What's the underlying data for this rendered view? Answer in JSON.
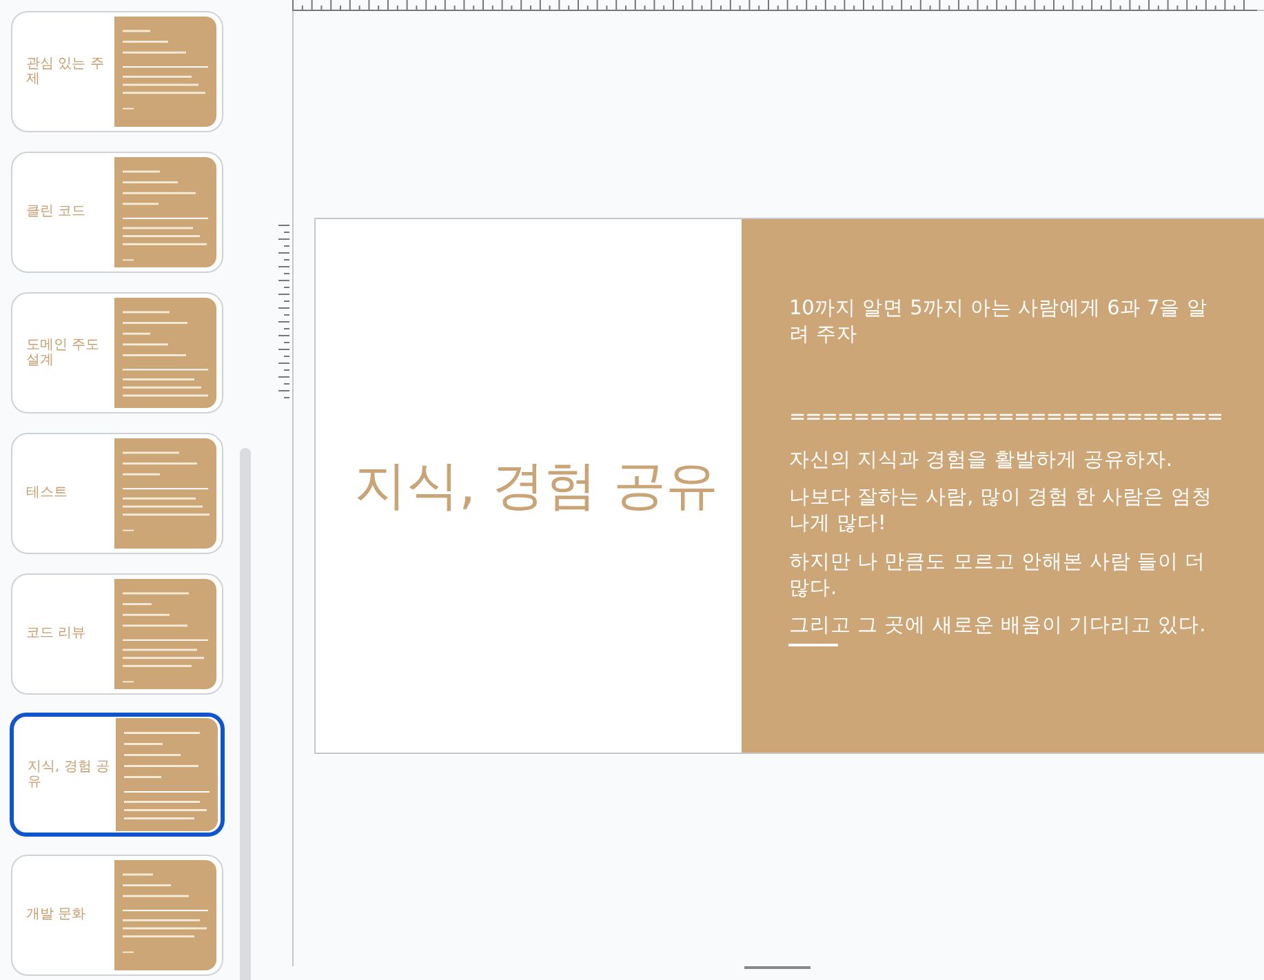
{
  "slides": [
    {
      "title": "관심 있는 주제",
      "selected": false
    },
    {
      "title": "클린 코드",
      "selected": false
    },
    {
      "title": "도메인 주도 설계",
      "selected": false
    },
    {
      "title": "테스트",
      "selected": false
    },
    {
      "title": "코드 리뷰",
      "selected": false
    },
    {
      "title": "지식, 경험 공유",
      "selected": true
    },
    {
      "title": "개발 문화",
      "selected": false
    }
  ],
  "current_slide": {
    "title": "지식, 경험 공유",
    "lead": "10까지 알면 5까지 아는 사람에게 6과 7을 알려 주자",
    "separator": "===========================",
    "paragraphs": [
      "자신의 지식과 경험을 활발하게 공유하자.",
      "나보다 잘하는 사람, 많이 경험 한 사람은 엄청나게 많다!",
      "하지만 나 만큼도 모르고 안해본 사람 들이 더 많다.",
      "그리고 그 곳에 새로운 배움이 기다리고 있다."
    ]
  }
}
